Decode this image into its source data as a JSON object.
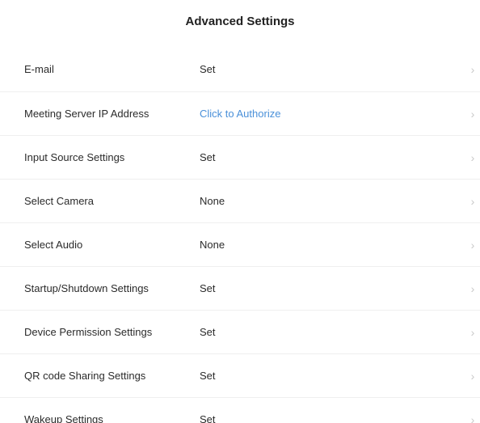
{
  "header": {
    "title": "Advanced Settings"
  },
  "settings": {
    "items": [
      {
        "label": "E-mail",
        "value": "Set",
        "is_link": false
      },
      {
        "label": "Meeting Server IP Address",
        "value": "Click to Authorize",
        "is_link": true
      },
      {
        "label": "Input Source Settings",
        "value": "Set",
        "is_link": false
      },
      {
        "label": "Select Camera",
        "value": "None",
        "is_link": false
      },
      {
        "label": "Select Audio",
        "value": "None",
        "is_link": false
      },
      {
        "label": "Startup/Shutdown Settings",
        "value": "Set",
        "is_link": false
      },
      {
        "label": "Device Permission Settings",
        "value": "Set",
        "is_link": false
      },
      {
        "label": "QR code Sharing Settings",
        "value": "Set",
        "is_link": false
      },
      {
        "label": "Wakeup Settings",
        "value": "Set",
        "is_link": false
      }
    ]
  },
  "icons": {
    "row_arrow": "chevron-right-icon"
  },
  "colors": {
    "link": "#4a90d9",
    "text": "#2b2b2b",
    "chevron": "#c9c9c9",
    "background": "#ffffff"
  }
}
